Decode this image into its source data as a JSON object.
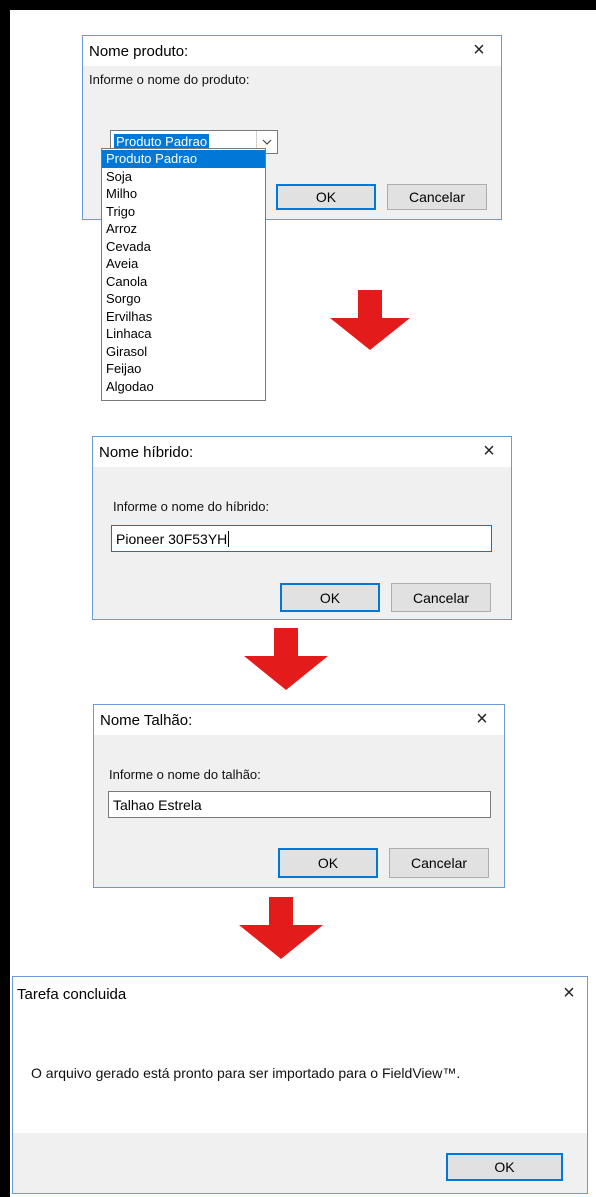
{
  "colors": {
    "arrow": "#e31b1b",
    "accent": "#0078d7"
  },
  "dialog1": {
    "title": "Nome produto:",
    "prompt": "Informe o nome do produto:",
    "selected": "Produto Padrao",
    "options": [
      "Produto Padrao",
      "Soja",
      "Milho",
      "Trigo",
      "Arroz",
      "Cevada",
      "Aveia",
      "Canola",
      "Sorgo",
      "Ervilhas",
      "Linhaca",
      "Girasol",
      "Feijao",
      "Algodao"
    ],
    "ok": "OK",
    "cancel": "Cancelar"
  },
  "dialog2": {
    "title": "Nome híbrido:",
    "prompt": "Informe o nome do híbrido:",
    "value": "Pioneer 30F53YH",
    "ok": "OK",
    "cancel": "Cancelar"
  },
  "dialog3": {
    "title": "Nome Talhão:",
    "prompt": "Informe o nome do talhão:",
    "value": "Talhao Estrela",
    "ok": "OK",
    "cancel": "Cancelar"
  },
  "dialog4": {
    "title": "Tarefa concluida",
    "message": "O arquivo gerado está pronto para ser importado para o FieldView™.",
    "ok": "OK"
  },
  "icons": {
    "close": "×",
    "chevron": "⌄"
  }
}
